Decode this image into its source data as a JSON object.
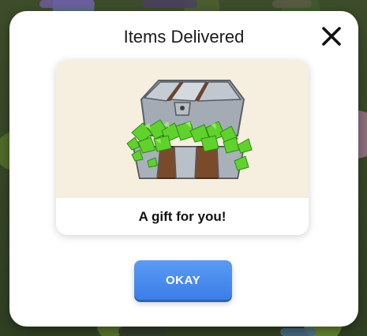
{
  "dialog": {
    "title": "Items Delivered",
    "close_icon": "close-icon"
  },
  "reward_card": {
    "image_icon": "treasure-chest-with-green-gems-icon",
    "caption": "A gift for you!"
  },
  "actions": {
    "okay_label": "OKAY"
  },
  "colors": {
    "button_blue": "#3b7ee6",
    "card_background": "#f6efdf",
    "gem_green": "#5fd32c",
    "chest_metal": "#9aa3ad"
  }
}
